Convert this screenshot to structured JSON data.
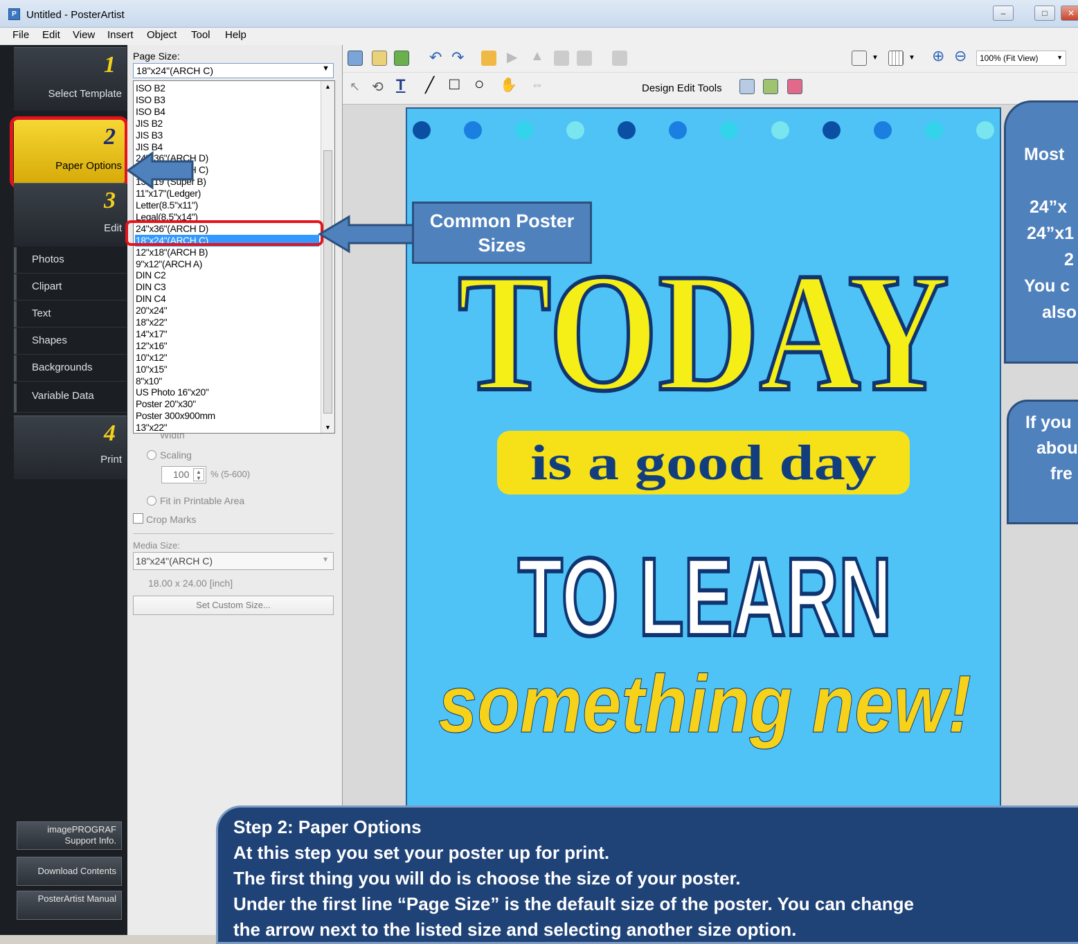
{
  "window": {
    "title": "Untitled - PosterArtist"
  },
  "menu": [
    "File",
    "Edit",
    "View",
    "Insert",
    "Object",
    "Tool",
    "Help"
  ],
  "steps": [
    {
      "num": "1",
      "label": "Select Template"
    },
    {
      "num": "2",
      "label": "Paper Options"
    },
    {
      "num": "3",
      "label": "Edit"
    },
    {
      "num": "4",
      "label": "Print"
    }
  ],
  "edit_items": [
    "Photos",
    "Clipart",
    "Text",
    "Shapes",
    "Backgrounds",
    "Variable Data"
  ],
  "bottom_buttons": [
    "imagePROGRAF Support Info.",
    "Download Contents",
    "PosterArtist Manual"
  ],
  "paper": {
    "page_size_label": "Page Size:",
    "page_size_value": "18\"x24\"(ARCH C)",
    "width_label": "Width",
    "scaling_label": "Scaling",
    "scaling_value": "100",
    "scaling_range": "% (5-600)",
    "fit_label": "Fit in Printable Area",
    "crop_label": "Crop Marks",
    "media_label": "Media Size:",
    "media_value": "18\"x24\"(ARCH C)",
    "media_dims": "18.00 x 24.00 [inch]",
    "custom_btn": "Set Custom Size..."
  },
  "dropdown": [
    "ISO B2",
    "ISO B3",
    "ISO B4",
    "JIS B2",
    "JIS B3",
    "JIS B4",
    "24\"x36\"(ARCH D)",
    "18\"x24\"(ARCH C)",
    "13\"x19\"(Super B)",
    "11\"x17\"(Ledger)",
    "Letter(8.5\"x11\")",
    "Legal(8.5\"x14\")",
    "24\"x36\"(ARCH D)",
    "18\"x24\"(ARCH C)",
    "12\"x18\"(ARCH B)",
    "9\"x12\"(ARCH A)",
    "DIN C2",
    "DIN C3",
    "DIN C4",
    "20\"x24\"",
    "18\"x22\"",
    "14\"x17\"",
    "12\"x16\"",
    "10\"x12\"",
    "10\"x15\"",
    "8\"x10\"",
    "US Photo 16\"x20\"",
    "Poster 20\"x30\"",
    "Poster 300x900mm",
    "13\"x22\""
  ],
  "dropdown_selected": 13,
  "toolbar": {
    "design_edit_label": "Design Edit Tools",
    "zoom": "100% (Fit View)"
  },
  "poster": {
    "line1": "TODAY",
    "line2": "is a good day",
    "line3": "TO LEARN",
    "line4": "something new!"
  },
  "callouts": {
    "common": "Common Poster Sizes",
    "side1": [
      "Most",
      "",
      "24”x",
      "24”x1",
      "2",
      "You c",
      "also"
    ],
    "side2": [
      "If you",
      "abou",
      "fre"
    ],
    "bottom": [
      "Step 2: Paper Options",
      "At this step you set your poster up for print.",
      "The first thing you will do is choose the size of your poster.",
      "Under the first line “Page Size” is the default size of the poster.  You can change",
      "the arrow next to the listed size and selecting another size option."
    ]
  },
  "colors": {
    "poster_bg": "#4fc3f5",
    "callout": "#4f81bd",
    "highlight": "#e3141b",
    "step_active": "#f3c71b"
  },
  "dot_colors": [
    "#0b4fa3",
    "#1a7fe0",
    "#34d3ec",
    "#79e5ef",
    "#0b4fa3",
    "#1a7fe0",
    "#34d3ec",
    "#79e5ef",
    "#0b4fa3",
    "#1a7fe0",
    "#34d3ec",
    "#79e5ef"
  ]
}
